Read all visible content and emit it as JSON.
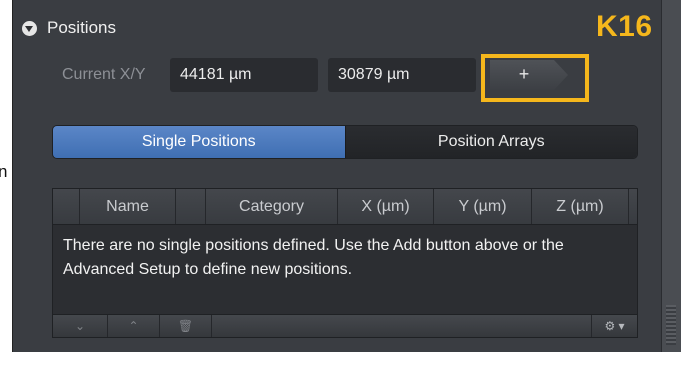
{
  "edge_text": "n",
  "annotation": {
    "label": "K16",
    "color": "#f5b71c"
  },
  "panel": {
    "title": "Positions",
    "collapse_icon": "chevron-down-circle",
    "current_xy": {
      "label": "Current X/Y",
      "x_value": "44181 µm",
      "y_value": "30879 µm"
    },
    "add_button_label": "+",
    "tabs": [
      {
        "label": "Single Positions",
        "active": true
      },
      {
        "label": "Position Arrays",
        "active": false
      }
    ],
    "table": {
      "columns": [
        "Name",
        "Category",
        "X (µm)",
        "Y (µm)",
        "Z (µm)"
      ],
      "empty_message": "There are no single positions defined. Use the Add button above or the Advanced Setup to define new positions."
    },
    "toolbar": {
      "move_down": "⌄",
      "move_up": "⌃",
      "delete": "🗑",
      "settings": "⚙ ▾"
    }
  },
  "colors": {
    "panel_bg": "#3a3d42",
    "tab_active": "#4a78bd",
    "field_bg": "#2a2c30"
  }
}
